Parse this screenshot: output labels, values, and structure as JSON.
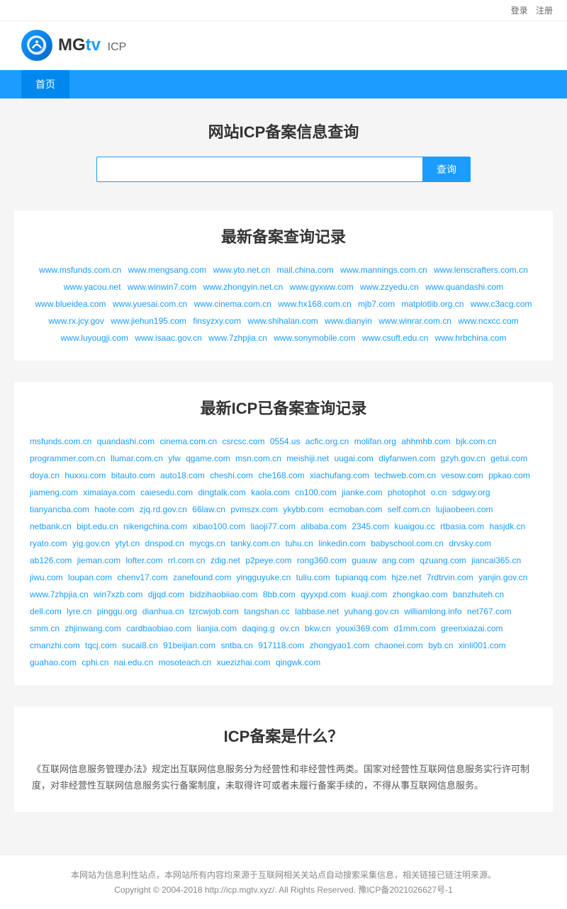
{
  "topbar": {
    "login": "登录",
    "register": "注册"
  },
  "header": {
    "logo_text_mg": "MG",
    "logo_text_tv": "tv",
    "icp_label": "ICP"
  },
  "nav": {
    "items": [
      {
        "label": "首页",
        "active": true
      }
    ]
  },
  "search_section": {
    "title": "网站ICP备案信息查询",
    "placeholder": "",
    "button_label": "查询"
  },
  "recent_section": {
    "title": "最新备案查询记录",
    "links": [
      "www.msfunds.com.cn",
      "www.mengsang.com",
      "www.yto.net.cn",
      "mail.china.com",
      "www.mannings.com.cn",
      "www.lenscrafters.com.cn",
      "www.yacou.net",
      "www.winwin7.com",
      "www.zhongyin.net.cn",
      "www.gyxww.com",
      "www.zzyedu.cn",
      "www.quandashi.com",
      "www.blueidea.com",
      "www.yuesai.com.cn",
      "www.cinema.com.cn",
      "www.hx168.com.cn",
      "mjb7.com",
      "matplotlib.org.cn",
      "www.c3acg.com",
      "www.rx.jcy.gov",
      "www.jiehun195.com",
      "finsyzxy.com",
      "www.shihalan.com",
      "www.dianyin",
      "www.winrar.com.cn",
      "www.ncxcc.com",
      "www.luyougji.com",
      "www.isaac.gov.cn",
      "www.7zhpjia.cn",
      "www.sonymobile.com",
      "www.csuft.edu.cn",
      "www.hrbchina.com"
    ]
  },
  "icp_section": {
    "title": "最新ICP已备案查询记录",
    "links": [
      "msfunds.com.cn",
      "quandashi.com",
      "cinema.com.cn",
      "csrcsc.com",
      "0554.us",
      "acfic.org.cn",
      "molifan.org",
      "ahhmhb.com",
      "bjk.com.cn",
      "programmer.com.cn",
      "llumar.com.cn",
      "ylw",
      "qgame.com",
      "msn.com.cn",
      "meishiji.net",
      "uugai.com",
      "diyfanwen.com",
      "gzyh.gov.cn",
      "getui.com",
      "doya.cn",
      "huxxu.com",
      "bitauto.com",
      "auto18.com",
      "cheshi.com",
      "che168.com",
      "xiachufang.com",
      "techweb.com.cn",
      "vesow.com",
      "ppkao.com",
      "jiameng.com",
      "ximalaya.com",
      "caiesedu.com",
      "dingtalk.com",
      "kaola.com",
      "cn100.com",
      "jianke.com",
      "photophot",
      "o.cn",
      "sdgwy.org",
      "tianyancba.com",
      "haote.com",
      "zjq.rd.gov.cn",
      "66law.cn",
      "pvmszx.com",
      "ykybb.com",
      "ecmoban.com",
      "self.com.cn",
      "lujiaobeen.com",
      "netbank.cn",
      "bipt.edu.cn",
      "nikengchina.com",
      "xibao100.com",
      "liaoji77.com",
      "alibaba.com",
      "2345.com",
      "kuaigou.cc",
      "rtbasia.com",
      "hasjdk.cn",
      "ryato.com",
      "yig.gov.cn",
      "ytyt.cn",
      "dnspod.cn",
      "mycgs.cn",
      "tanky.com.cn",
      "tuhu.cn",
      "linkedin.com",
      "babyschool.com.cn",
      "drvsky.com",
      "ab126.com",
      "jieman.com",
      "lofter.com",
      "rrl.com.cn",
      "zdig.net",
      "p2peye.com",
      "rong360.com",
      "guauw",
      "ang.com",
      "qzuang.com",
      "jiancai365.cn",
      "jiwu.com",
      "loupan.com",
      "chenv17.com",
      "zanefound.com",
      "yingguyuke.cn",
      "tuliu.com",
      "tupianqq.com",
      "hjze.net",
      "7rdtrvin.com",
      "yanjin.gov.cn",
      "www.7zhpjia.cn",
      "win7xzb.com",
      "djjqd.com",
      "bidzihaobiiao.com",
      "8bb.com",
      "qyyxpd.com",
      "kuaji.com",
      "zhongkao.com",
      "banzhuteh.cn",
      "dell.com",
      "lyre.cn",
      "pinggu.org",
      "dianhua.cn",
      "tzrcwjob.com",
      "tangshan.cc",
      "labbase.net",
      "yuhang.gov.cn",
      "williamlong.info",
      "net767.com",
      "smm.cn",
      "zhjinwang.com",
      "cardbaobiao.com",
      "lianjia.com",
      "daqing.g",
      "ov.cn",
      "bkw.cn",
      "youxi369.com",
      "d1mm.com",
      "greenxiazai.com",
      "cmanzhi.com",
      "tqcj.com",
      "sucai8.cn",
      "91beijian.com",
      "sntba.cn",
      "917118.com",
      "zhongyao1.com",
      "chaonei.com",
      "byb.cn",
      "xinli001.com",
      "guahao.com",
      "cphi.cn",
      "nai.edu.cn",
      "mosoteach.cn",
      "xuezizhai.com",
      "qingwk.com"
    ]
  },
  "what_section": {
    "title": "ICP备案是什么？",
    "content": "《互联网信息服务管理办法》规定出互联网信息服务分为经营性和非经营性两类。国家对经营性互联网信息服务实行许可制度，对非经营性互联网信息服务实行备案制度，未取得许可或者未履行备案手续的，不得从事互联网信息服务。"
  },
  "footer": {
    "disclaimer": "本网站为信息利性站点，本网站所有内容均来源于互联网相关关站点自动搜索采集信息，相关链接已链注明来源。",
    "copyright": "Copyright © 2004-2018 http://icp.mgtv.xyz/. All Rights Reserved. 豫ICP备2021026627号-1"
  }
}
